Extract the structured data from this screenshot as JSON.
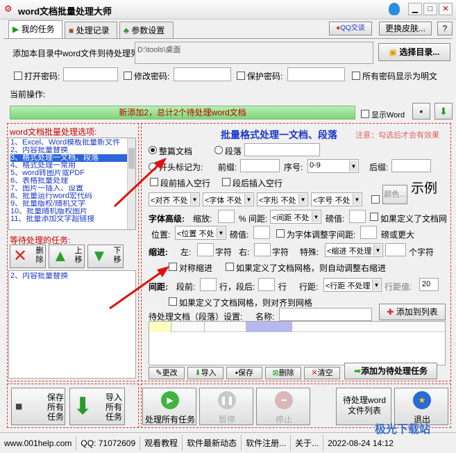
{
  "window": {
    "title": "word文档批量处理大师",
    "min": "▁",
    "max": "□",
    "close": "✕"
  },
  "tabs": [
    {
      "label": "我的任务"
    },
    {
      "label": "处理记录"
    },
    {
      "label": "参数设置"
    }
  ],
  "top_right": {
    "qq_label": "QQ交谈",
    "skin_button": "更换皮肤...",
    "help": "?"
  },
  "add_dir": {
    "label": "添加本目录中word文件到待处理列表:",
    "path": "D:\\tools\\桌面",
    "select_button": "选择目录..."
  },
  "passwords": {
    "open": "打开密码:",
    "modify": "修改密码:",
    "protect": "保护密码:",
    "show_plain": "所有密码显示为明文"
  },
  "current_op": {
    "label": "当前操作:",
    "progress_text": "新添加2，总计2个待处理word文档",
    "show_word": "显示Word"
  },
  "options_list": {
    "header": "word文档批量处理选项:",
    "items": [
      "1、Excel、Word模板批量新文件",
      "2、内容批量替换",
      "3、格式处理一文档、段落",
      "4、格式处理一常用",
      "5、word转图片或PDF",
      "6、表格批量处理",
      "7、图片一插入、设置",
      "8、批量运行word宏代码",
      "9、批量版权/随机文字",
      "10、批量随机版权图片",
      "11、批量添加文字超链接"
    ],
    "selected": 2
  },
  "pending": {
    "header": "等待处理的任务:",
    "delete": "删除",
    "up": "上移",
    "down": "下移",
    "items": [
      "2、内容批量替换"
    ]
  },
  "panel": {
    "title": "批量格式处理一文档、段落",
    "note": "注意：勾选后才会有效果",
    "whole_doc": "整篇文档",
    "paragraph": "段落",
    "start_marker": "开头标记为:",
    "prefix": "前缀:",
    "seq": "序号:",
    "seq_value": "0-9",
    "suffix": "后缀:",
    "before_blank": "段前插入空行",
    "after_blank": "段后插入空行",
    "combos_row1": [
      "<对齐 不处",
      "<字体 不处",
      "<字形 不处",
      "<字号 不处"
    ],
    "color_button": "颜色...",
    "example": "示例",
    "font_adv": "字体高级:",
    "scale": "缩放:",
    "percent_spacing": "% 间距:",
    "spacing_combo": "<间距 不处",
    "pound1": "磅值:",
    "grid_note1": "如果定义了文档网",
    "position": "位置:",
    "pos_combo": "<位置 不处",
    "pound2": "磅值:",
    "adjust_spacing": "为字体调整字间距:",
    "pound_more": "磅或更大",
    "indent": "缩进:",
    "left": "左:",
    "char1": "字符",
    "right": "右:",
    "char2": "字符",
    "special": "特殊:",
    "indent_combo": "<缩进 不处理",
    "char3": "个字符",
    "sym_indent": "对称缩进",
    "grid_indent": "如果定义了文档网格，则自动调整右缩进",
    "spacing": "间距:",
    "before": "段前:",
    "line_after": "行，段后:",
    "line2": "行",
    "linespacing": "行距:",
    "ls_combo": "<行距 不处理",
    "ls_value_label": "行距值:",
    "ls_value": "20",
    "grid_align": "如果定义了文档网格，则对齐到网格",
    "pending_setting": "待处理文档（段落）设置:",
    "name": "名称:",
    "add_to_list": "添加到列表",
    "buttons": {
      "modify": "更改",
      "import": "导入",
      "save": "保存",
      "delete": "删除",
      "clear": "清空",
      "add_task": "添加为待处理任务"
    }
  },
  "bottom": {
    "save_all": "保存所有任务",
    "import_all": "导入所有任务",
    "process_all": "处理所有任务",
    "pause": "暂停",
    "stop": "停止",
    "pending_list": "待处理word文件列表",
    "exit": "退出"
  },
  "status": {
    "site": "www.001help.com",
    "qq": "QQ: 71072609",
    "tutorial": "观看教程",
    "news": "软件最新动态",
    "register": "软件注册...",
    "about": "关于...",
    "datetime": "2022-08-24  14:12",
    "watermark": "极光下载站"
  },
  "colors": {
    "accent_blue": "#1a37c8",
    "red": "#c00",
    "progress_green": "#8fd98a"
  }
}
